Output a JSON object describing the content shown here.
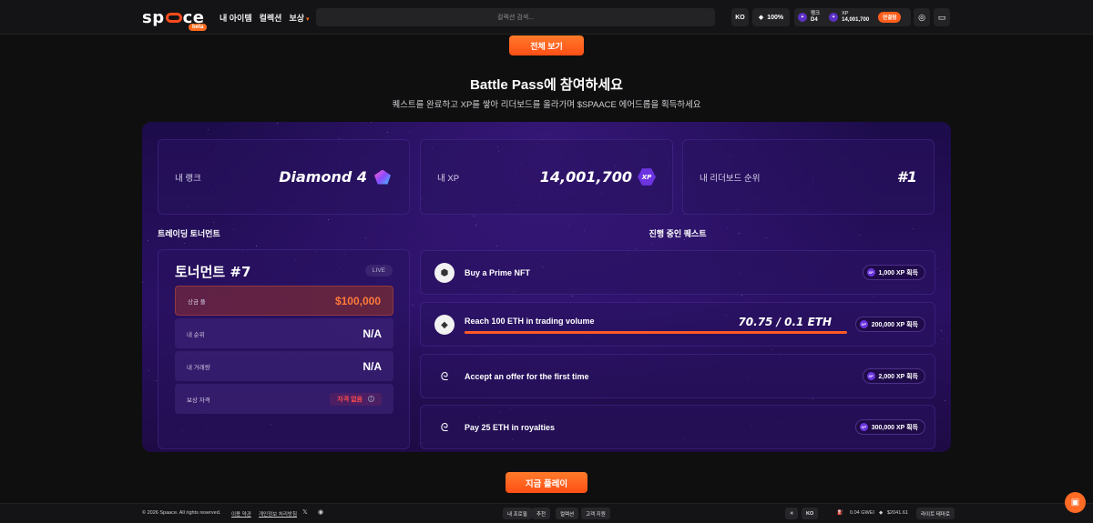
{
  "header": {
    "logo": "spaace",
    "beta": "beta",
    "nav": [
      "내 아이템",
      "컬렉션",
      "보상"
    ],
    "search_placeholder": "컬렉션 검색...",
    "lang": "KO",
    "zoom": "100%",
    "rank_label": "랭크",
    "rank_value": "D4",
    "xp_label": "XP",
    "xp_value": "14,001,700",
    "connect": "연결됨"
  },
  "view_all": "전체 보기",
  "battle_pass": {
    "title": "Battle Pass에 참여하세요",
    "subtitle": "퀘스트를 완료하고 XP를 쌓아 리더보드를 올라가며 $SPAACE 에어드롭을 획득하세요"
  },
  "stats": [
    {
      "label": "내 랭크",
      "value": "Diamond 4"
    },
    {
      "label": "내 XP",
      "value": "14,001,700",
      "badge": "XP"
    },
    {
      "label": "내 리더보드 순위",
      "value": "#1"
    }
  ],
  "tournament": {
    "section_title": "트레이딩 토너먼트",
    "title": "토너먼트 #7",
    "live": "LIVE",
    "prize_label": "상금 풀",
    "prize_value": "$100,000",
    "rank_label": "내 순위",
    "rank_value": "N/A",
    "volume_label": "내 거래량",
    "volume_value": "N/A",
    "eligibility_label": "보상 자격",
    "eligibility_value": "자격 없음"
  },
  "quests": {
    "section_title": "진행 중인 퀘스트",
    "items": [
      {
        "label": "Buy a Prime NFT",
        "reward": "1,000 XP 획득"
      },
      {
        "label": "Reach 100 ETH in trading volume",
        "progress": "70.75 / 0.1 ETH",
        "progress_fraction": 1.0,
        "reward": "200,000 XP 획득"
      },
      {
        "label": "Accept an offer for the first time",
        "reward": "2,000 XP 획득"
      },
      {
        "label": "Pay 25 ETH in royalties",
        "reward": "300,000 XP 획득"
      }
    ]
  },
  "play_now": "지금 플레이",
  "footer": {
    "copyright": "© 2026 Spaace. All rights reserved.",
    "terms": "이용 약관",
    "privacy": "개인정보 처리방침",
    "tabs": [
      "내 프로필",
      "추천",
      "컬렉션",
      "고객 지원"
    ],
    "lang": "KO",
    "gas": "0.04 GWEI",
    "eth_price": "$2041.61",
    "theme": "라이트 테마로"
  },
  "colors": {
    "accent": "#ff5e1c",
    "panel_bg": "#2a1063",
    "page_bg": "#0f0f10"
  }
}
